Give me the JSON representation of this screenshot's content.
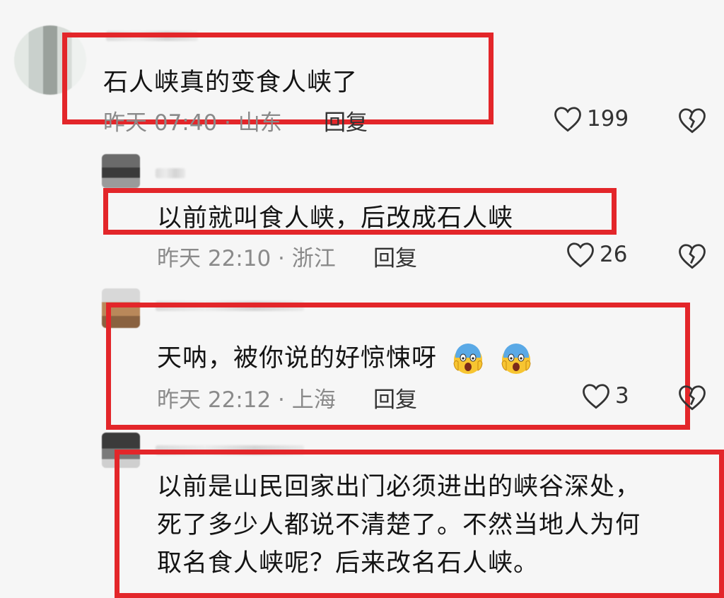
{
  "comments": [
    {
      "text": "石人峡真的变食人峡了",
      "time": "昨天 07:40 · 山东",
      "reply": "回复",
      "likes": "199"
    },
    {
      "text": "以前就叫食人峡，后改成石人峡",
      "time": "昨天 22:10 · 浙江",
      "reply": "回复",
      "likes": "26"
    },
    {
      "text": "天呐，被你说的好惊悚呀",
      "time": "昨天 22:12 · 上海",
      "reply": "回复",
      "likes": "3"
    },
    {
      "lines": [
        "以前是山民回家出门必须进出的峡谷深处，",
        "死了多少人都说不清楚了。不然当地人为何",
        "取名食人峡呢？后来改名石人峡。"
      ]
    }
  ],
  "icons": {
    "like": "heart-outline-icon",
    "dislike": "broken-heart-icon",
    "emoji": "screaming-face-emoji"
  },
  "colors": {
    "highlight_box": "#e3262a",
    "meta_text": "#8a8a8a",
    "background": "#f6f6f6"
  }
}
